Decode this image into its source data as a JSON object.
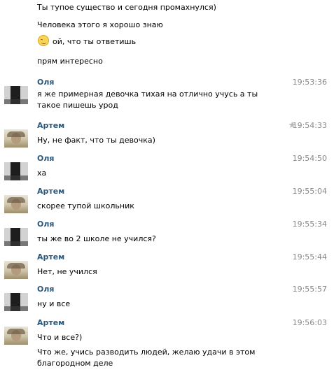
{
  "top_lines": [
    "Ты тупое существо и сегодня промахнулся)",
    "Человека этого я хорошо знаю",
    "ой, что ты ответишь",
    "прям интересно"
  ],
  "messages": [
    {
      "author": "Оля",
      "time": "19:53:36",
      "text": "я же примерная девочка тихая на отлично учусь а ты такое пишешь урод"
    },
    {
      "author": "Артем",
      "time": "19:54:33",
      "text": "Ну, не факт, что ты девочка)"
    },
    {
      "author": "Оля",
      "time": "19:54:50",
      "text": "ха"
    },
    {
      "author": "Артем",
      "time": "19:55:04",
      "text": "скорее тупой школьник"
    },
    {
      "author": "Оля",
      "time": "19:55:34",
      "text": "ты же во 2 школе не учился?"
    },
    {
      "author": "Артем",
      "time": "19:55:44",
      "text": "Нет, не учился"
    },
    {
      "author": "Оля",
      "time": "19:55:57",
      "text": "ну и все"
    },
    {
      "author": "Артем",
      "time": "19:56:03",
      "text": "Что и все?)"
    }
  ],
  "extra_line": "Что же, учись разводить людей, желаю удачи в этом благородном деле",
  "icons": {
    "emoji": "smile-emoji-icon",
    "star": "star-icon"
  }
}
